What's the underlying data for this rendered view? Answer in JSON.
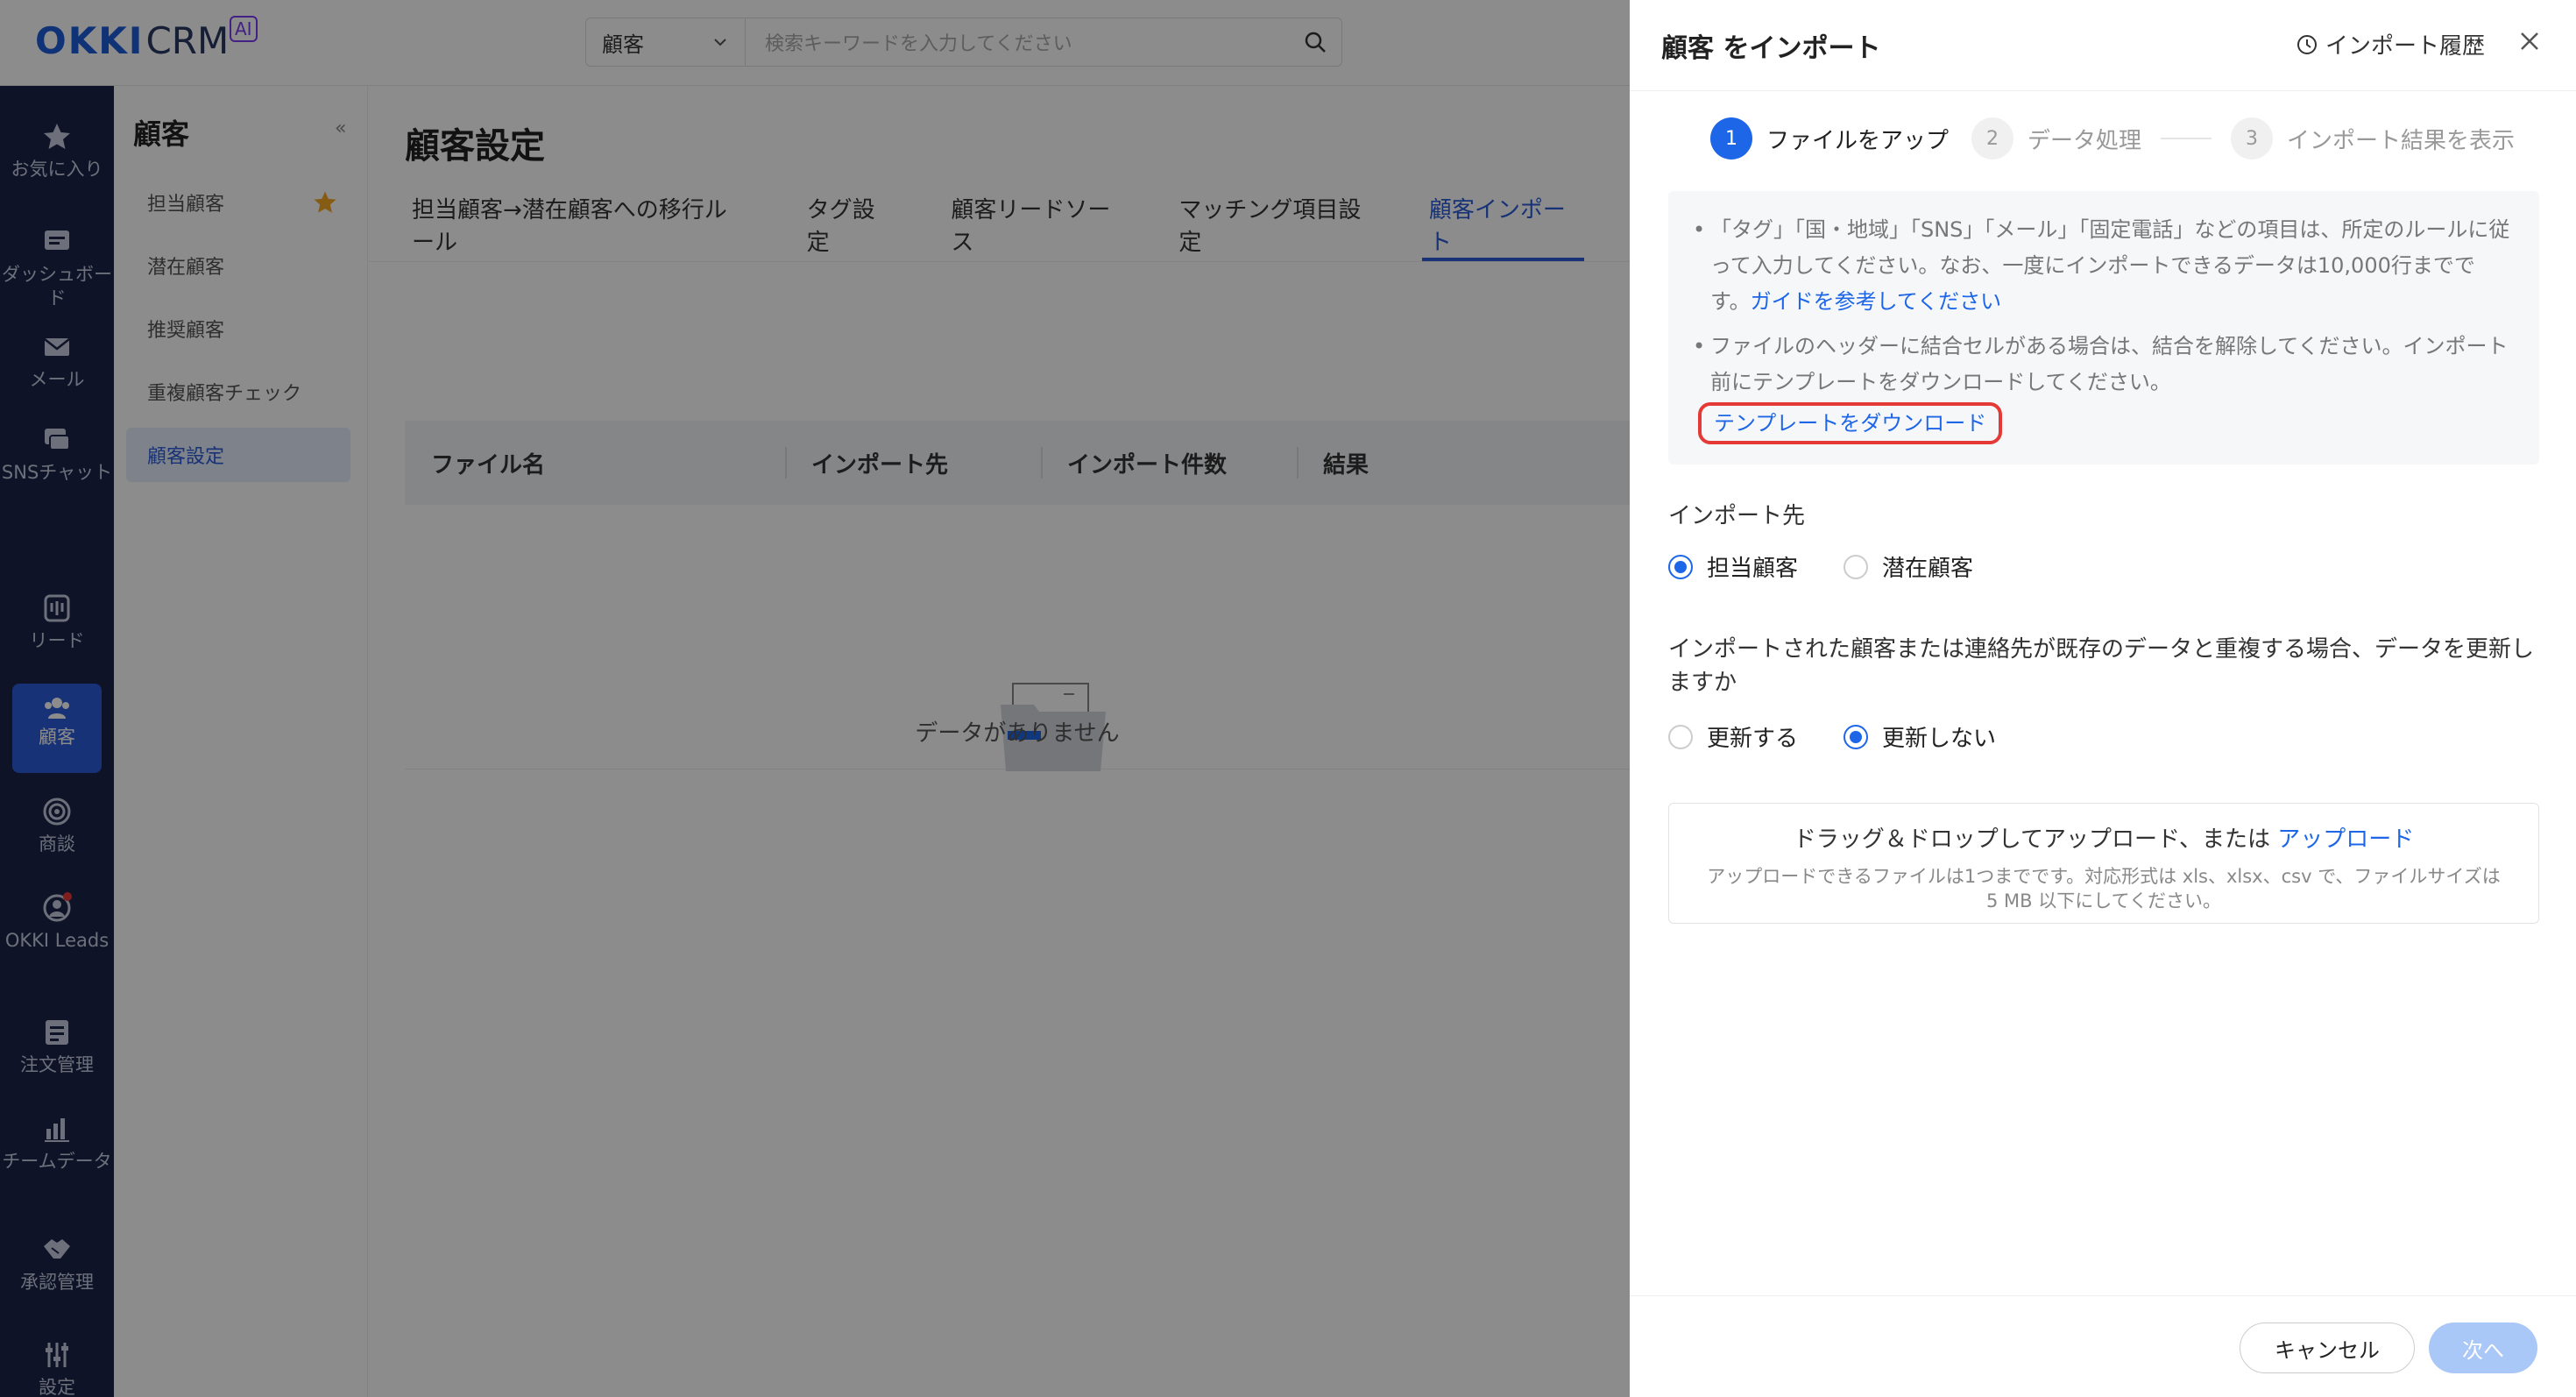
{
  "brand": {
    "okki": "OKKI",
    "crm": "CRM",
    "ai": "AI"
  },
  "search": {
    "scope": "顧客",
    "placeholder": "検索キーワードを入力してください"
  },
  "leftnav": [
    {
      "label": "お気に入り",
      "icon": "star-icon"
    },
    {
      "label": "ダッシュボード",
      "icon": "dashboard-icon"
    },
    {
      "label": "メール",
      "icon": "mail-icon"
    },
    {
      "label": "SNSチャット",
      "icon": "chat-icon"
    },
    {
      "label": "リード",
      "icon": "lead-icon"
    },
    {
      "label": "顧客",
      "icon": "customers-icon",
      "active": true
    },
    {
      "label": "商談",
      "icon": "target-icon"
    },
    {
      "label": "OKKI Leads",
      "icon": "okki-leads-icon"
    },
    {
      "label": "注文管理",
      "icon": "order-icon"
    },
    {
      "label": "チームデータ",
      "icon": "bar-chart-icon"
    },
    {
      "label": "承認管理",
      "icon": "handshake-icon"
    },
    {
      "label": "設定",
      "icon": "settings-icon"
    }
  ],
  "subnav": {
    "title": "顧客",
    "collapse": "«",
    "items": [
      "担当顧客",
      "潜在顧客",
      "推奨顧客",
      "重複顧客チェック",
      "顧客設定"
    ]
  },
  "main": {
    "title": "顧客設定",
    "tabs": [
      "担当顧客→潜在顧客への移行ルール",
      "タグ設定",
      "顧客リードソース",
      "マッチング項目設定",
      "顧客インポート"
    ],
    "columns": [
      "ファイル名",
      "インポート先",
      "インポート件数",
      "結果"
    ],
    "empty": "データがありません"
  },
  "drawer": {
    "title": "顧客 をインポート",
    "history": "インポート履歴",
    "steps": [
      {
        "num": "1",
        "label": "ファイルをアップ"
      },
      {
        "num": "2",
        "label": "データ処理"
      },
      {
        "num": "3",
        "label": "インポート結果を表示"
      }
    ],
    "info1": "「タグ」「国・地域」「SNS」「メール」「固定電話」などの項目は、所定のルールに従って入力してください。なお、一度にインポートできるデータは10,000行までです。",
    "guide_link": "ガイドを参考してください",
    "info2": "ファイルのヘッダーに結合セルがある場合は、結合を解除してください。インポート前にテンプレートをダウンロードしてください。",
    "template_link": "テンプレートをダウンロード",
    "dest_label": "インポート先",
    "dest_options": [
      "担当顧客",
      "潜在顧客"
    ],
    "dup_label": "インポートされた顧客または連絡先が既存のデータと重複する場合、データを更新しますか",
    "dup_options": [
      "更新する",
      "更新しない"
    ],
    "upload_text": "ドラッグ＆ドロップしてアップロード、または",
    "upload_link": "アップロード",
    "upload_note": "アップロードできるファイルは1つまでです。対応形式は xls、xlsx、csv で、ファイルサイズは 5 MB 以下にしてください。",
    "cancel": "キャンセル",
    "next": "次へ"
  }
}
